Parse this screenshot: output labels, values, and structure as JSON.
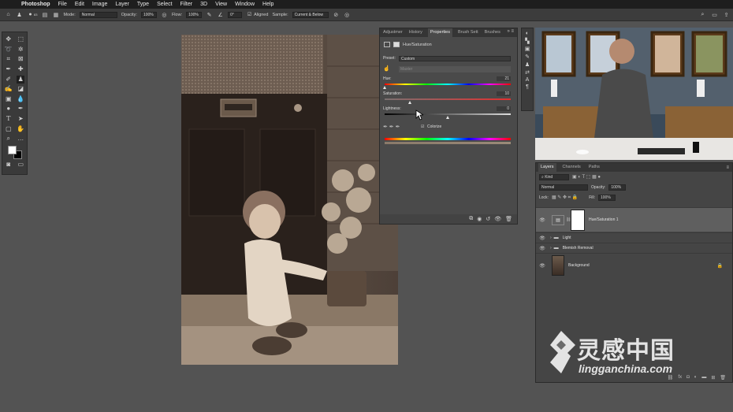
{
  "menubar": {
    "app": "Photoshop",
    "items": [
      "File",
      "Edit",
      "Image",
      "Layer",
      "Type",
      "Select",
      "Filter",
      "3D",
      "View",
      "Window",
      "Help"
    ]
  },
  "options": {
    "brush_size": "83",
    "mode_label": "Mode:",
    "mode_value": "Normal",
    "opacity_label": "Opacity:",
    "opacity_value": "100%",
    "flow_label": "Flow:",
    "flow_value": "100%",
    "angle_value": "0°",
    "aligned_label": "Aligned",
    "sample_label": "Sample:",
    "sample_value": "Current & Below"
  },
  "properties": {
    "tabs": [
      "Adjustmer",
      "History",
      "Properties",
      "Brush Sett",
      "Brushes"
    ],
    "active_tab": "Properties",
    "title": "Hue/Saturation",
    "preset_label": "Preset:",
    "preset_value": "Custom",
    "channel_value": "Master",
    "hue_label": "Hue:",
    "hue_value": "21",
    "saturation_label": "Saturation:",
    "saturation_value": "10",
    "lightness_label": "Lightness:",
    "lightness_value": "0",
    "colorize_label": "Colorize",
    "hue_fraction": 0.0,
    "saturation_fraction": 0.2,
    "lightness_fraction": 0.5
  },
  "layers": {
    "tabs": [
      "Layers",
      "Channels",
      "Paths"
    ],
    "active_tab": "Layers",
    "filter_value": "Kind",
    "blend_value": "Normal",
    "opacity_label": "Opacity:",
    "opacity_value": "100%",
    "lock_label": "Lock:",
    "fill_label": "Fill:",
    "fill_value": "100%",
    "items": [
      {
        "name": "Hue/Saturation 1",
        "type": "adjustment",
        "selected": true
      },
      {
        "name": "Light",
        "type": "group"
      },
      {
        "name": "Blemish Removal",
        "type": "group"
      },
      {
        "name": "Background",
        "type": "image",
        "locked": true
      }
    ]
  },
  "watermark": {
    "cn": "灵感中国",
    "en": "lingganchina.com"
  }
}
